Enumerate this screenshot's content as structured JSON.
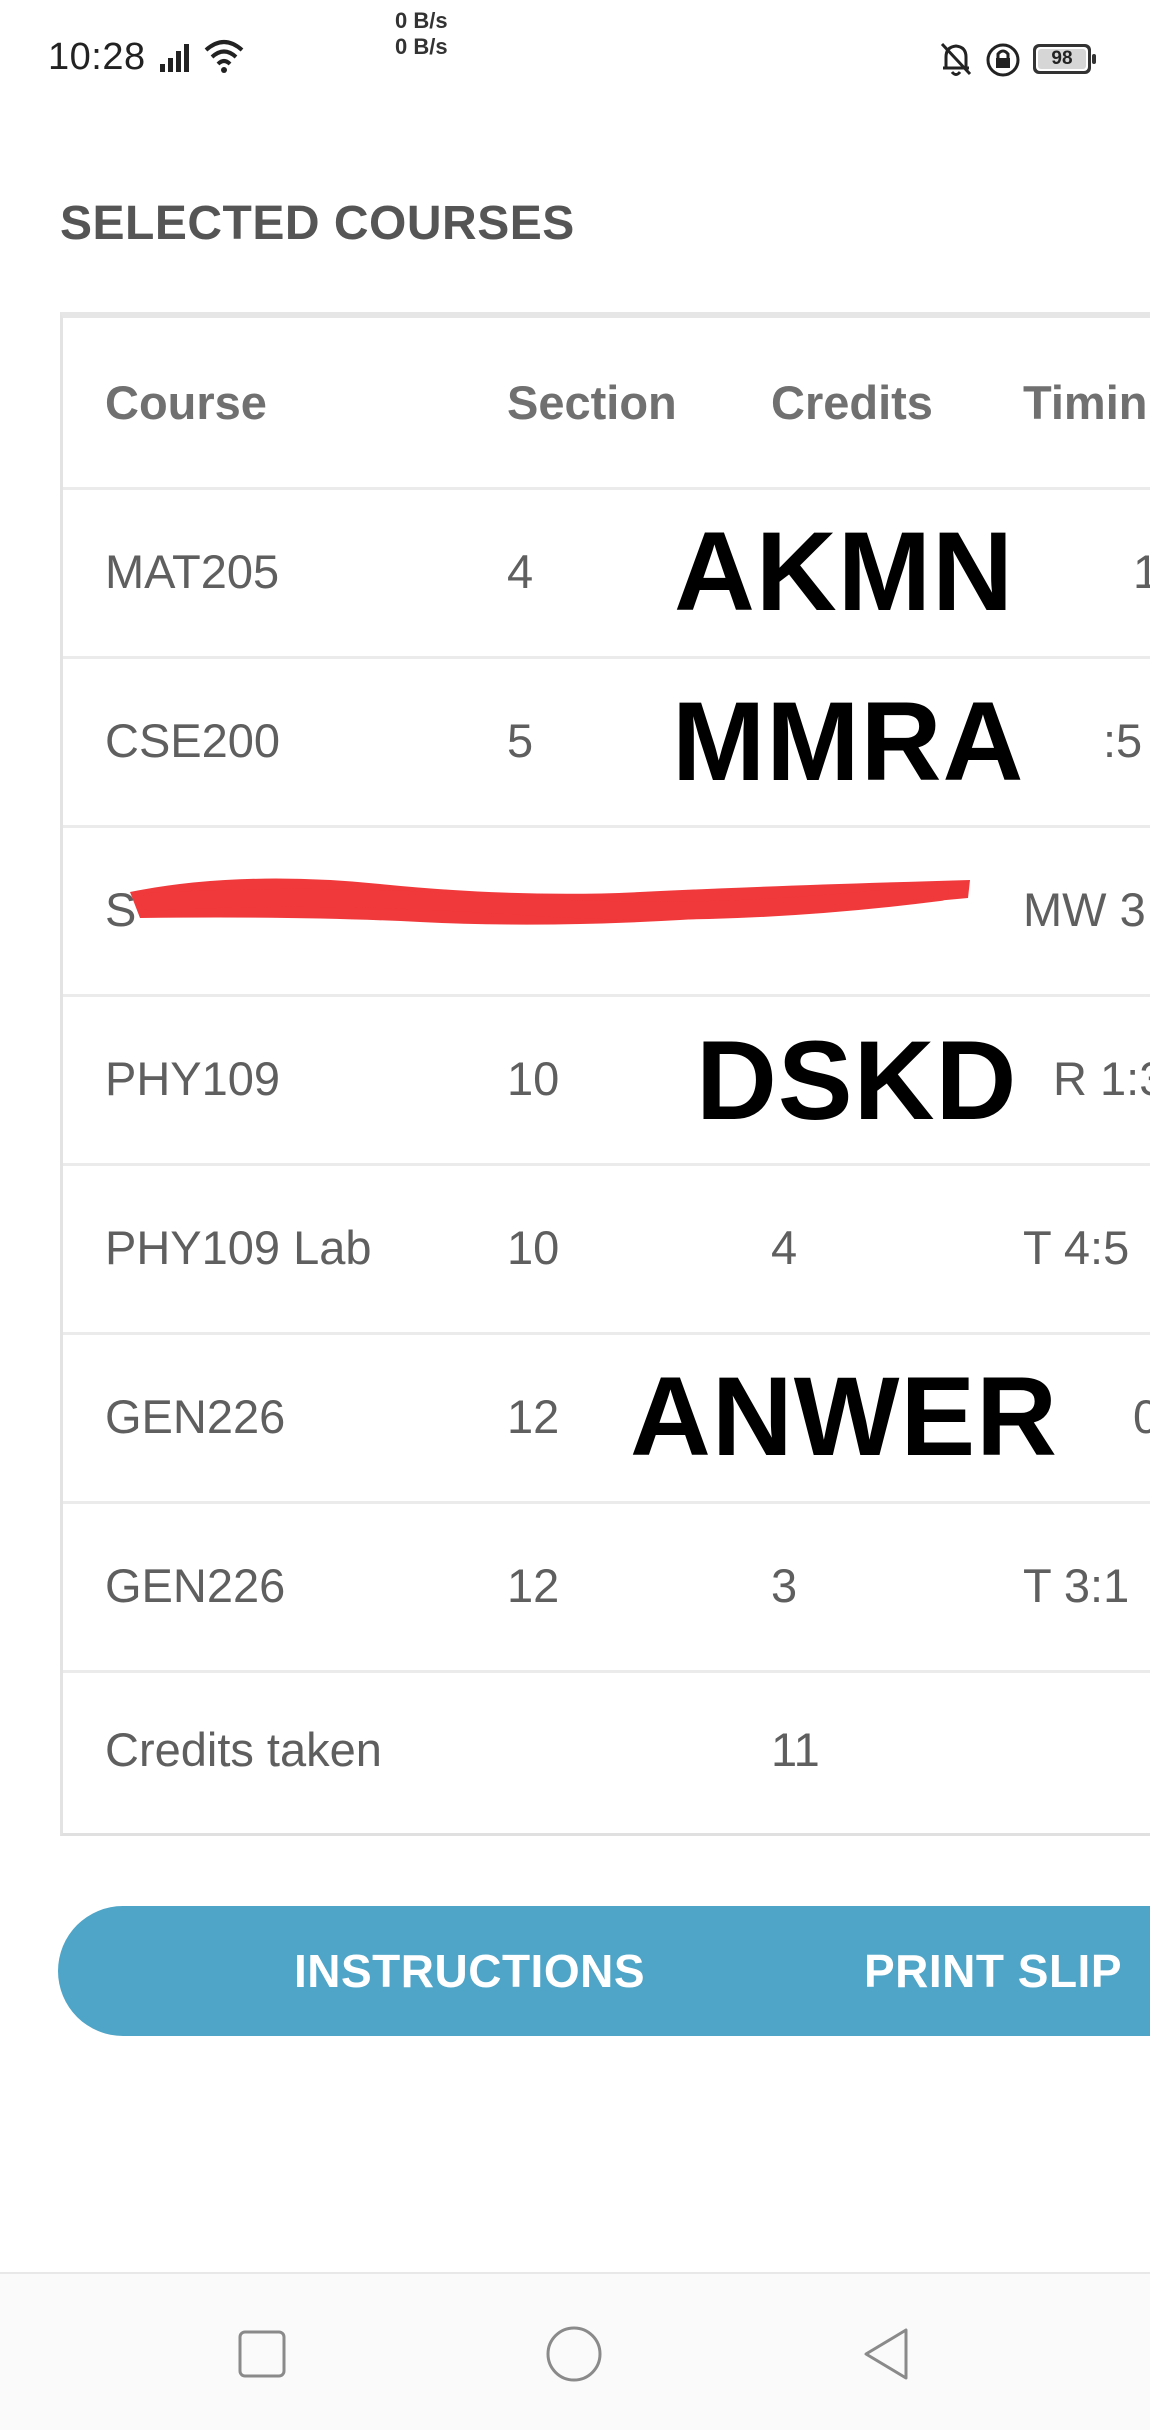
{
  "status_bar": {
    "time": "10:28",
    "speed_up": "0 B/s",
    "speed_down": "0 B/s",
    "battery": "98"
  },
  "page": {
    "heading": "SELECTED COURSES"
  },
  "table": {
    "headers": [
      "Course",
      "Section",
      "Credits",
      "Timin"
    ],
    "rows": [
      {
        "course": "MAT205",
        "section": "4",
        "credits": "",
        "timing": "1"
      },
      {
        "course": "CSE200",
        "section": "5",
        "credits": "",
        "timing": ":5"
      },
      {
        "course": "S",
        "section": "",
        "credits": "",
        "timing": "MW 3"
      },
      {
        "course": "PHY109",
        "section": "10",
        "credits": "",
        "timing": "R 1:3"
      },
      {
        "course": "PHY109 Lab",
        "section": "10",
        "credits": "4",
        "timing": "T 4:5"
      },
      {
        "course": "GEN226",
        "section": "12",
        "credits": "",
        "timing": "0"
      },
      {
        "course": "GEN226",
        "section": "12",
        "credits": "3",
        "timing": "T 3:1"
      }
    ],
    "footer": {
      "label": "Credits taken",
      "credits": "11"
    }
  },
  "overlays": [
    "AKMN",
    "MMRA",
    "DSKD",
    "ANWER"
  ],
  "buttons": {
    "instructions": "INSTRUCTIONS",
    "print_slip": "PRINT SLIP"
  },
  "colors": {
    "accent": "#4ea5c8",
    "redaction": "#f0393b"
  },
  "nav_icons": [
    "recent-apps-icon",
    "home-icon",
    "back-icon"
  ]
}
